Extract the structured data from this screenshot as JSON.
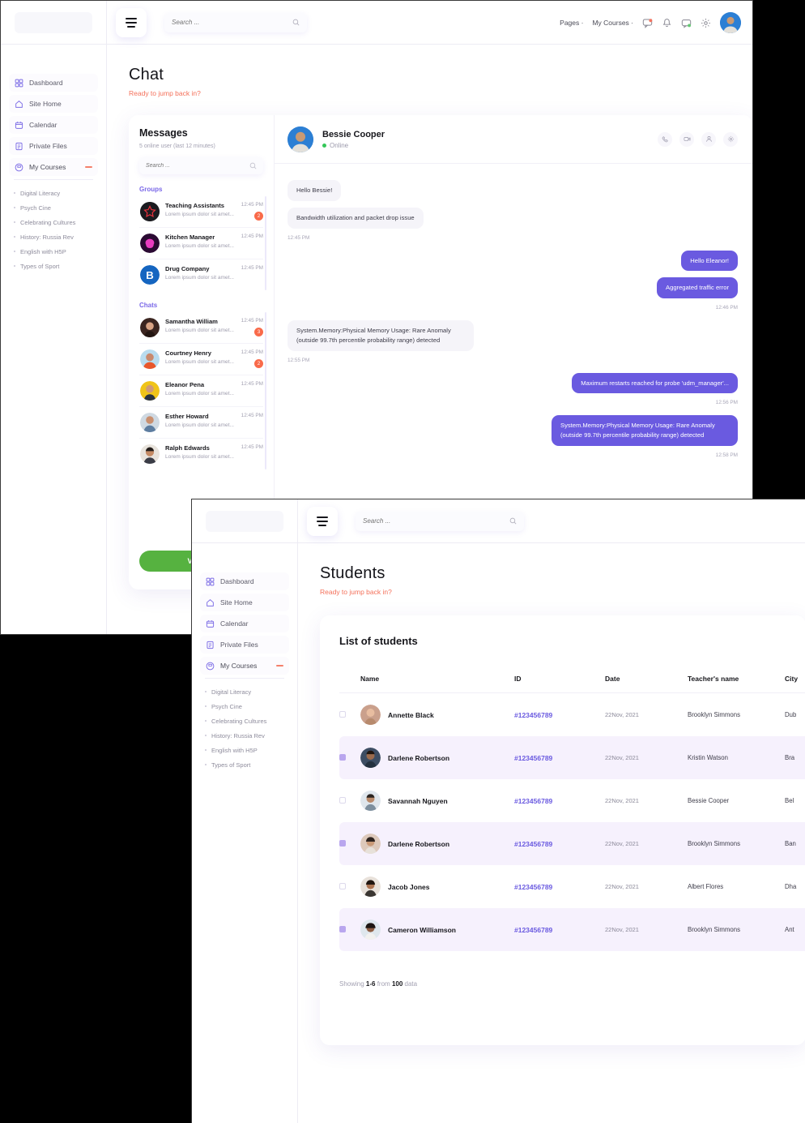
{
  "windows": {
    "chat": {
      "topbar": {
        "search_placeholder": "Search ...",
        "nav": [
          {
            "label": "Pages ·"
          },
          {
            "label": "My Courses ·"
          }
        ],
        "icons": [
          {
            "name": "chat-bubble-icon"
          },
          {
            "name": "bell-icon"
          },
          {
            "name": "message-icon"
          },
          {
            "name": "gear-icon"
          }
        ]
      },
      "sidebar": {
        "items": [
          {
            "label": "Dashboard",
            "icon": "grid-icon"
          },
          {
            "label": "Site Home",
            "icon": "home-icon"
          },
          {
            "label": "Calendar",
            "icon": "calendar-icon"
          },
          {
            "label": "Private Files",
            "icon": "file-icon"
          },
          {
            "label": "My Courses",
            "icon": "book-icon",
            "active": true
          }
        ],
        "courses": [
          {
            "label": "Digital Literacy"
          },
          {
            "label": "Psych Cine"
          },
          {
            "label": "Celebrating Cultures"
          },
          {
            "label": "History: Russia Rev"
          },
          {
            "label": "English with H5P"
          },
          {
            "label": "Types of Sport"
          }
        ]
      },
      "page": {
        "title": "Chat",
        "subtitle": "Ready to jump back in?"
      },
      "messages_pane": {
        "title": "Messages",
        "subtitle": "5 online user (last 12 minutes)",
        "search_placeholder": "Search ...",
        "groups_label": "Groups",
        "chats_label": "Chats",
        "view_button": "View All",
        "groups": [
          {
            "name": "Teaching Assistants",
            "preview": "Lorem ipsum dolor sit amet...",
            "time": "12:45 PM",
            "badge": "2",
            "color": "#1b1b20"
          },
          {
            "name": "Kitchen Manager",
            "preview": "Lorem ipsum dolor sit amet...",
            "time": "12:45 PM",
            "badge": "",
            "color": "#2b0a33"
          },
          {
            "name": "Drug Company",
            "preview": "Lorem ipsum dolor sit amet...",
            "time": "12:45 PM",
            "badge": "",
            "color": "#1565c0"
          }
        ],
        "chats": [
          {
            "name": "Samantha William",
            "preview": "Lorem ipsum dolor sit amet...",
            "time": "12:45 PM",
            "badge": "3",
            "color": "#3b2520"
          },
          {
            "name": "Courtney Henry",
            "preview": "Lorem ipsum dolor sit amet...",
            "time": "12:45 PM",
            "badge": "2",
            "color": "#e8572c"
          },
          {
            "name": "Eleanor Pena",
            "preview": "Lorem ipsum dolor sit amet...",
            "time": "12:45 PM",
            "badge": "",
            "color": "#f0c419"
          },
          {
            "name": "Esther Howard",
            "preview": "Lorem ipsum dolor sit amet...",
            "time": "12:45 PM",
            "badge": "",
            "color": "#8d6f58"
          },
          {
            "name": "Ralph Edwards",
            "preview": "Lorem ipsum dolor sit amet...",
            "time": "12:45 PM",
            "badge": "",
            "color": "#4c3b33"
          }
        ]
      },
      "conversation": {
        "name": "Bessie Cooper",
        "status": "Online",
        "actions": [
          {
            "name": "phone-icon"
          },
          {
            "name": "video-camera-icon"
          },
          {
            "name": "user-icon"
          },
          {
            "name": "gear-icon"
          }
        ],
        "thread": [
          {
            "side": "in",
            "text": "Hello Bessie!"
          },
          {
            "side": "in",
            "text": "Bandwidth utilization and packet drop issue",
            "time": "12:45 PM"
          },
          {
            "side": "out",
            "text": "Hello Eleanor!"
          },
          {
            "side": "out",
            "text": "Aggregated traffic error",
            "time": "12:46 PM"
          },
          {
            "side": "in",
            "text": "System.Memory:Physical Memory Usage: Rare Anomaly (outside 99.7th percentile probability range) detected",
            "time": "12:55 PM"
          },
          {
            "side": "out",
            "text": "Maximum restarts reached for probe 'udm_manager'...",
            "time": "12:56 PM"
          },
          {
            "side": "out",
            "text": "System.Memory:Physical Memory Usage: Rare Anomaly (outside 99.7th percentile probability range) detected",
            "time": "12:58 PM"
          }
        ]
      }
    },
    "students": {
      "topbar": {
        "search_placeholder": "Search ..."
      },
      "sidebar": {
        "items": [
          {
            "label": "Dashboard",
            "icon": "grid-icon"
          },
          {
            "label": "Site Home",
            "icon": "home-icon"
          },
          {
            "label": "Calendar",
            "icon": "calendar-icon"
          },
          {
            "label": "Private Files",
            "icon": "file-icon"
          },
          {
            "label": "My Courses",
            "icon": "book-icon",
            "active": true
          }
        ],
        "courses": [
          {
            "label": "Digital Literacy"
          },
          {
            "label": "Psych Cine"
          },
          {
            "label": "Celebrating Cultures"
          },
          {
            "label": "History: Russia Rev"
          },
          {
            "label": "English with H5P"
          },
          {
            "label": "Types of Sport"
          }
        ]
      },
      "page": {
        "title": "Students",
        "subtitle": "Ready to jump back in?"
      },
      "table": {
        "card_title": "List of students",
        "columns": [
          "Name",
          "ID",
          "Date",
          "Teacher's name",
          "City"
        ],
        "rows": [
          {
            "checked": false,
            "name": "Annette Black",
            "id": "#123456789",
            "date": "22Nov, 2021",
            "teacher": "Brooklyn Simmons",
            "city": "Dub",
            "color": "#caa08c"
          },
          {
            "checked": true,
            "name": "Darlene Robertson",
            "id": "#123456789",
            "date": "22Nov, 2021",
            "teacher": "Kristin Watson",
            "city": "Bra",
            "color": "#3d4d63"
          },
          {
            "checked": false,
            "name": "Savannah Nguyen",
            "id": "#123456789",
            "date": "22Nov, 2021",
            "teacher": "Bessie Cooper",
            "city": "Bel",
            "color": "#a9b7c4"
          },
          {
            "checked": true,
            "name": "Darlene Robertson",
            "id": "#123456789",
            "date": "22Nov, 2021",
            "teacher": "Brooklyn Simmons",
            "city": "Ban",
            "color": "#ddc9bb"
          },
          {
            "checked": false,
            "name": "Jacob Jones",
            "id": "#123456789",
            "date": "22Nov, 2021",
            "teacher": "Albert Flores",
            "city": "Dha",
            "color": "#6b4b3a"
          },
          {
            "checked": true,
            "name": "Cameron Williamson",
            "id": "#123456789",
            "date": "22Nov, 2021",
            "teacher": "Brooklyn Simmons",
            "city": "Ant",
            "color": "#4a3b36"
          }
        ],
        "footer": {
          "prefix": "Showing ",
          "range": "1-6",
          "middle": " from ",
          "total": "100",
          "suffix": " data"
        }
      }
    }
  },
  "colors": {
    "accent_purple": "#6a5ae0",
    "sub_red": "#f4705a",
    "green_button": "#56b240",
    "badge_orange": "#f96a4a",
    "row_alt": "#f6f1fd",
    "online_green": "#34c759"
  }
}
